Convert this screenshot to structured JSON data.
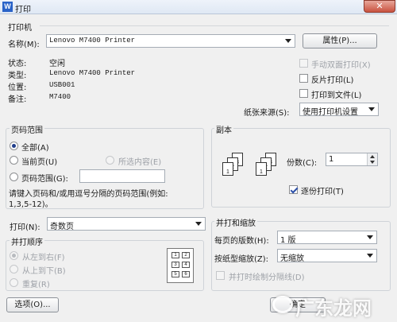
{
  "window": {
    "title": "打印",
    "app_icon_letter": "W",
    "close_symbol": "✕"
  },
  "printer": {
    "group_label": "打印机",
    "name_label": "名称(M):",
    "name_value": "Lenovo M7400 Printer",
    "properties_button": "属性(P)...",
    "status_label": "状态:",
    "status_value": "空闲",
    "type_label": "类型:",
    "type_value": "Lenovo M7400 Printer",
    "location_label": "位置:",
    "location_value": "USB001",
    "comment_label": "备注:",
    "comment_value": "M7400",
    "manual_duplex": "手动双面打印(X)",
    "reverse_print": "反片打印(L)",
    "print_to_file": "打印到文件(L)",
    "paper_source_label": "纸张来源(S):",
    "paper_source_value": "使用打印机设置"
  },
  "page_range": {
    "group_label": "页码范围",
    "all": "全部(A)",
    "current_page": "当前页(U)",
    "selection": "所选内容(E)",
    "pages": "页码范围(G):",
    "pages_input_value": "",
    "hint_line1": "请键入页码和/或用逗号分隔的页码范围(例如:",
    "hint_line2": "1,3,5-12)。"
  },
  "copies": {
    "group_label": "副本",
    "count_label": "份数(C):",
    "count_value": "1",
    "collate": "逐份打印(T)",
    "page_labels": [
      "3",
      "2",
      "1"
    ]
  },
  "print_what": {
    "label": "打印(N):",
    "value": "奇数页"
  },
  "print_order": {
    "group_label": "并打顺序",
    "left_to_right": "从左到右(F)",
    "top_to_bottom": "从上到下(B)",
    "repeat": "重复(R)",
    "preview_cells": [
      "1",
      "2",
      "3",
      "4",
      "5",
      "6"
    ]
  },
  "zoom": {
    "group_label": "并打和缩放",
    "pages_per_sheet_label": "每页的版数(H):",
    "pages_per_sheet_value": "1 版",
    "scale_label": "按纸型缩放(Z):",
    "scale_value": "无缩放",
    "draw_separator": "并打时绘制分隔线(D)"
  },
  "footer": {
    "options_button": "选项(O)...",
    "ok_button": "确定"
  },
  "watermark": {
    "text": "广东龙网"
  }
}
